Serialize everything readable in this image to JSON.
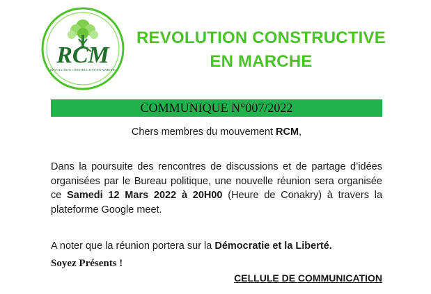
{
  "logo": {
    "letters": "RCM",
    "ring_text": "REVOLUTION CONSTRUCTIVE EN MARCHE",
    "brand_green": "#4cc22a",
    "dark_green": "#1f6f2a"
  },
  "header": {
    "title_line1": "REVOLUTION CONSTRUCTIVE",
    "title_line2": "EN MARCHE"
  },
  "banner": {
    "text": "COMMUNIQUE N°007/2022",
    "color": "#22b14c"
  },
  "greeting": {
    "prefix": "Chers membres du mouvement ",
    "bold": "RCM",
    "suffix": ","
  },
  "body": {
    "part1": "Dans la poursuite des rencontres de discussions et de partage d’idées organisées par le Bureau politique, une nouvelle réunion sera organisée ce ",
    "bold": "Samedi 12 Mars 2022 à 20H00",
    "part2": " (Heure de Conakry) à travers la  plateforme Google meet."
  },
  "note": {
    "prefix": "A noter que la réunion portera  sur la ",
    "bold": "Démocratie et  la Liberté."
  },
  "closing": "Soyez Présents !",
  "signature": "CELLULE DE COMMUNICATION"
}
